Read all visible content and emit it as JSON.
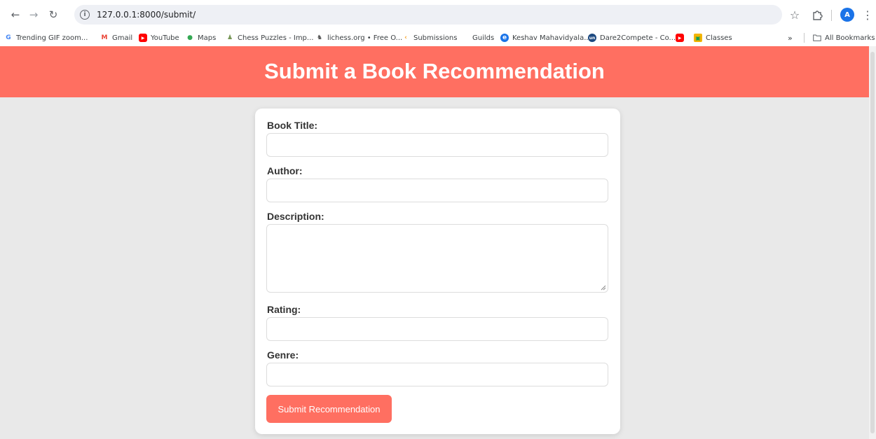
{
  "browser": {
    "url": "127.0.0.1:8000/submit/",
    "avatar_letter": "A",
    "bookmarks": [
      {
        "label": "Trending GIF zoom...",
        "icon": "google-icon",
        "icon_char": "G",
        "color": "#4285f4"
      },
      {
        "label": "Gmail",
        "icon": "gmail-icon",
        "icon_char": "M",
        "color": "#ea4335"
      },
      {
        "label": "YouTube",
        "icon": "youtube-icon",
        "icon_char": "▶",
        "color": "#ff0000"
      },
      {
        "label": "Maps",
        "icon": "maps-icon",
        "icon_char": "●",
        "color": "#34a853"
      },
      {
        "label": "Chess Puzzles - Imp...",
        "icon": "chess-icon",
        "icon_char": "♟",
        "color": "#769656"
      },
      {
        "label": "lichess.org • Free O...",
        "icon": "lichess-icon",
        "icon_char": "♞",
        "color": "#555555"
      },
      {
        "label": "Submissions",
        "icon": "leetcode-icon",
        "icon_char": "‹",
        "color": "#f89f1b"
      },
      {
        "label": "Guilds",
        "icon": "guilds-icon",
        "icon_char": "",
        "color": "#ffffff"
      },
      {
        "label": "Keshav Mahavidyala...",
        "icon": "chrome-icon",
        "icon_char": "e",
        "color": "#1a73e8"
      },
      {
        "label": "Dare2Compete - Co...",
        "icon": "unstop-icon",
        "icon_char": "un",
        "color": "#1c4980"
      },
      {
        "label": "",
        "icon": "youtube-icon",
        "icon_char": "▶",
        "color": "#ff0000"
      },
      {
        "label": "Classes",
        "icon": "classroom-icon",
        "icon_char": "▣",
        "color": "#f4b400"
      }
    ],
    "more_label": "»",
    "all_bookmarks_label": "All Bookmarks"
  },
  "page": {
    "heading": "Submit a Book Recommendation",
    "form": {
      "title_label": "Book Title:",
      "title_value": "",
      "author_label": "Author:",
      "author_value": "",
      "description_label": "Description:",
      "description_value": "",
      "rating_label": "Rating:",
      "rating_value": "",
      "genre_label": "Genre:",
      "genre_value": "",
      "submit_label": "Submit Recommendation"
    }
  },
  "colors": {
    "accent": "#ff6f61",
    "page_bg": "#e9e9e9"
  }
}
